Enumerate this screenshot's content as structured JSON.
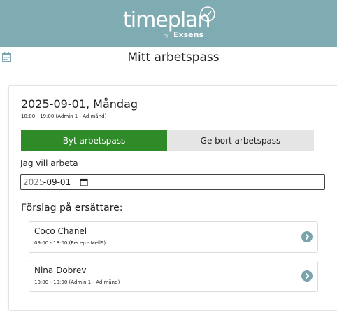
{
  "brand": {
    "logo_word": "timeplan",
    "logo_by": "by",
    "logo_company": "Exsens",
    "header_color": "#7fabb3"
  },
  "titlebar": {
    "icon": "calendar-icon",
    "title": "Mitt arbetspass"
  },
  "shift": {
    "date_heading": "2025-09-01, Måndag",
    "details": "10:00 - 19:00 (Admin 1 - Ad månd)"
  },
  "tabs": [
    {
      "label": "Byt arbetspass",
      "active": true
    },
    {
      "label": "Ge bort arbetspass",
      "active": false
    }
  ],
  "colors": {
    "active_tab": "#2e8b28",
    "inactive_tab": "#e5e5e5",
    "chevron": "#7aa3ad"
  },
  "form": {
    "want_label": "Jag vill arbeta",
    "date_year": "2025",
    "date_rest": "-09-01",
    "date_icon": "calendar-picker-icon"
  },
  "suggestions": {
    "heading": "Förslag på ersättare:",
    "items": [
      {
        "name": "Coco Chanel",
        "details": "09:00 - 18:00 (Recep - Mell9)",
        "icon": "chevron-right-icon"
      },
      {
        "name": "Nina Dobrev",
        "details": "10:00 - 19:00 (Admin 1 - Ad månd)",
        "icon": "chevron-right-icon"
      }
    ]
  }
}
